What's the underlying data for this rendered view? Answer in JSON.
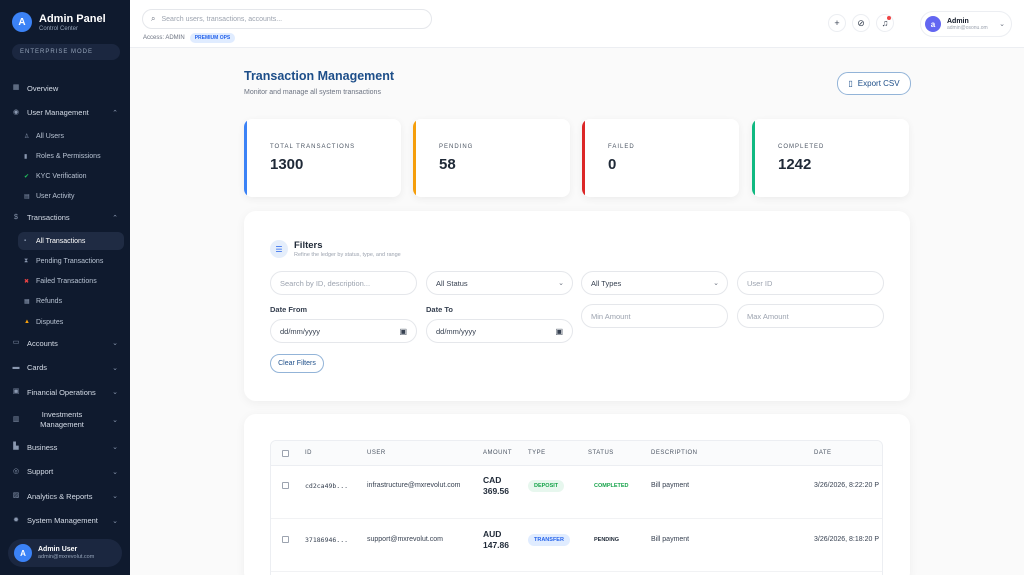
{
  "sidebar": {
    "brand_letter": "A",
    "brand_title": "Admin Panel",
    "brand_sub": "Control Center",
    "mode": "ENTERPRISE MODE",
    "overview": "Overview",
    "user_mgmt": "User Management",
    "user_sub": [
      "All Users",
      "Roles & Permissions",
      "KYC Verification",
      "User Activity"
    ],
    "transactions": "Transactions",
    "tx_sub": [
      "All Transactions",
      "Pending Transactions",
      "Failed Transactions",
      "Refunds",
      "Disputes"
    ],
    "accounts": "Accounts",
    "cards": "Cards",
    "financial_ops": "Financial Operations",
    "investments": "Investments Management",
    "business": "Business",
    "support": "Support",
    "analytics": "Analytics & Reports",
    "system": "System Management",
    "user": {
      "letter": "A",
      "name": "Admin User",
      "email": "admin@mxrevolut.com"
    }
  },
  "topbar": {
    "search_placeholder": "Search users, transactions, accounts...",
    "access_label": "Access: ADMIN",
    "premium": "PREMIUM OPS",
    "user": {
      "letter": "a",
      "name": "Admin",
      "email": "admin@osonu.om"
    }
  },
  "page": {
    "title": "Transaction Management",
    "subtitle": "Monitor and manage all system transactions",
    "export": "Export CSV"
  },
  "stats": [
    {
      "label": "TOTAL TRANSACTIONS",
      "value": "1300",
      "color": "#3b82f6"
    },
    {
      "label": "PENDING",
      "value": "58",
      "color": "#f59e0b"
    },
    {
      "label": "FAILED",
      "value": "0",
      "color": "#dc2626"
    },
    {
      "label": "COMPLETED",
      "value": "1242",
      "color": "#10b981"
    }
  ],
  "filters": {
    "title": "Filters",
    "subtitle": "Refine the ledger by status, type, and range",
    "search_placeholder": "Search by ID, description...",
    "status": "All Status",
    "types": "All Types",
    "user_id_placeholder": "User ID",
    "date_from_label": "Date From",
    "date_to_label": "Date To",
    "date_from": "dd/mm/yyyy",
    "date_to": "dd/mm/yyyy",
    "min_placeholder": "Min Amount",
    "max_placeholder": "Max Amount",
    "clear": "Clear Filters"
  },
  "table": {
    "headers": {
      "id": "ID",
      "user": "USER",
      "amount": "AMOUNT",
      "type": "TYPE",
      "status": "STATUS",
      "description": "DESCRIPTION",
      "date": "DATE"
    },
    "rows": [
      {
        "id": "cd2ca49b...",
        "user": "infrastructure@mxrevolut.com",
        "currency": "CAD",
        "amount": "369.56",
        "type": "DEPOSIT",
        "status": "COMPLETED",
        "description": "Bill payment",
        "date": "3/26/2026, 8:22:20 P"
      },
      {
        "id": "37186946...",
        "user": "support@mxrevolut.com",
        "currency": "AUD",
        "amount": "147.86",
        "type": "TRANSFER",
        "status": "PENDING",
        "description": "Bill payment",
        "date": "3/26/2026, 8:18:20 P"
      }
    ]
  }
}
